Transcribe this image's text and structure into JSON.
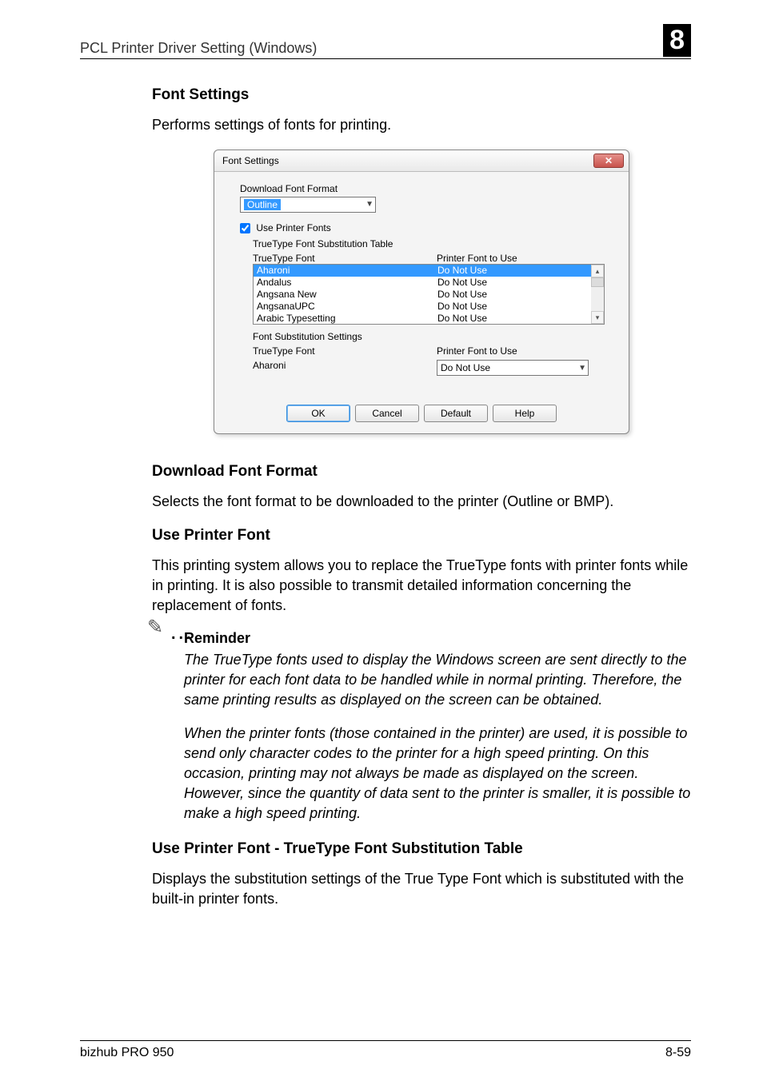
{
  "header": {
    "left": "PCL Printer Driver Setting (Windows)",
    "right": "8"
  },
  "sections": {
    "font_settings": {
      "title": "Font Settings",
      "intro": "Performs settings of fonts for printing."
    },
    "download_font_format": {
      "title": "Download Font Format",
      "body": "Selects the font format to be downloaded to the printer (Outline or BMP)."
    },
    "use_printer_font": {
      "title": "Use Printer Font",
      "body": "This printing system allows you to replace the TrueType fonts with printer fonts while in printing. It is also possible to transmit detailed information concerning the replacement of fonts."
    },
    "reminder": {
      "title": "Reminder",
      "p1": "The TrueType fonts used to display the Windows screen are sent directly to the printer for each font data to be handled while in normal printing. Therefore, the same printing results as displayed on the screen can be obtained.",
      "p2": "When the printer fonts (those contained in the printer) are used, it is possible to send only character codes to the printer for a high speed printing. On this occasion, printing may not always be made as displayed on the screen. However, since the quantity of data sent to the printer is smaller, it is possible to make a high speed printing."
    },
    "subst_table": {
      "title": "Use Printer Font - TrueType Font Substitution Table",
      "body": "Displays the substitution settings of the True Type Font which is substituted with the built-in printer fonts."
    }
  },
  "dialog": {
    "title": "Font Settings",
    "download_label": "Download Font Format",
    "download_value": "Outline",
    "use_printer_fonts_label": "Use Printer Fonts",
    "use_printer_fonts_checked": true,
    "table_label": "TrueType Font Substitution Table",
    "cols": {
      "c1": "TrueType Font",
      "c2": "Printer Font to Use"
    },
    "rows": [
      {
        "font": "Aharoni",
        "use": "Do Not Use",
        "selected": true
      },
      {
        "font": "Andalus",
        "use": "Do Not Use",
        "selected": false
      },
      {
        "font": "Angsana New",
        "use": "Do Not Use",
        "selected": false
      },
      {
        "font": "AngsanaUPC",
        "use": "Do Not Use",
        "selected": false
      },
      {
        "font": "Arabic Typesetting",
        "use": "Do Not Use",
        "selected": false
      }
    ],
    "subst_settings_label": "Font Substitution Settings",
    "subst_cols": {
      "c1": "TrueType Font",
      "c2": "Printer Font to Use"
    },
    "subst_font": "Aharoni",
    "subst_value": "Do Not Use",
    "buttons": {
      "ok": "OK",
      "cancel": "Cancel",
      "default": "Default",
      "help": "Help"
    }
  },
  "footer": {
    "left": "bizhub PRO 950",
    "right": "8-59"
  }
}
